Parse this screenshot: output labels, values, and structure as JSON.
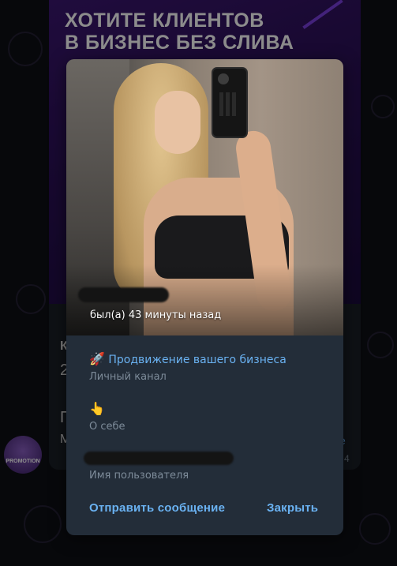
{
  "background": {
    "banner_title": "ХОТИТЕ КЛИЕНТОВ\nВ БИЗНЕС БЕЗ СЛИВА",
    "post_fragments": [
      "К",
      "2",
      "П",
      "М"
    ],
    "right_fragments": [
      "е",
      "4"
    ],
    "avatar_label": "PROMOTION",
    "colors": {
      "bg": "#0e1014",
      "banner": "#3b1670"
    }
  },
  "profile": {
    "status": "был(а) 43 минуты назад",
    "rows": [
      {
        "icon": "rocket-icon",
        "emoji": "🚀",
        "value": "Продвижение вашего бизнеса",
        "label": "Личный канал"
      },
      {
        "icon": "pointing-hand-icon",
        "emoji": "👆",
        "value": "",
        "label": "О себе"
      },
      {
        "value": "",
        "label": "Имя пользователя"
      }
    ],
    "actions": {
      "send": "Отправить сообщение",
      "close": "Закрыть"
    },
    "colors": {
      "popup_bg": "#232d39",
      "accent": "#6ab2f2",
      "label": "#7d8b99"
    }
  }
}
